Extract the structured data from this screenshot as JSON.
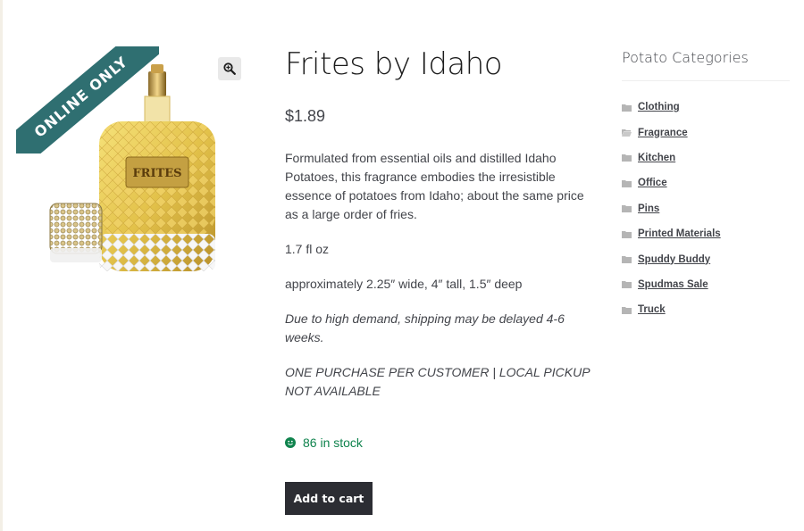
{
  "product": {
    "badge": "ONLINE ONLY",
    "bottle_label": "FRITES",
    "title": "Frites by Idaho",
    "price": "$1.89",
    "description": [
      "Formulated from essential oils and distilled Idaho Potatoes, this fragrance embodies the irresistible essence of potatoes from Idaho; about the same price as a large order of fries.",
      "1.7 fl oz",
      "approximately 2.25″ wide, 4″ tall, 1.5″ deep",
      "Due to high demand, shipping may be delayed 4-6 weeks.",
      "ONE PURCHASE PER CUSTOMER | LOCAL PICKUP NOT AVAILABLE"
    ],
    "stock": "86 in stock",
    "add_to_cart": "Add to cart"
  },
  "sidebar": {
    "title": "Potato Categories",
    "categories": [
      "Clothing",
      "Fragrance",
      "Kitchen",
      "Office",
      "Pins",
      "Printed Materials",
      "Spuddy Buddy",
      "Spudmas Sale",
      "Truck"
    ]
  },
  "icons": {
    "zoom": "magnifier-zoom-icon",
    "folder": "folder-icon",
    "folder_open": "folder-open-icon",
    "stock": "smiley-icon"
  },
  "colors": {
    "ribbon": "#2f6f71",
    "stock": "#0f834d",
    "button": "#2c2d33"
  }
}
